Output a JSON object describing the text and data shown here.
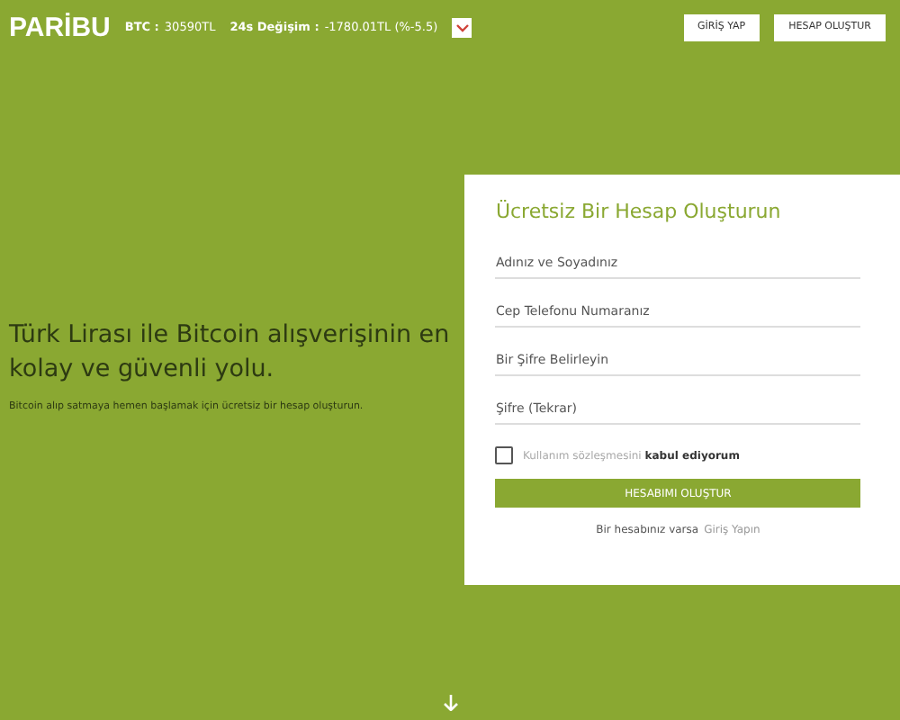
{
  "header": {
    "logo": "PARİBU",
    "ticker": [
      {
        "label": "BTC :",
        "value": "30590TL"
      },
      {
        "label": "24s Değişim :",
        "value": "-1780.01TL (%-5.5)"
      }
    ],
    "buttons": [
      "GİRİŞ YAP",
      "HESAP OLUŞTUR"
    ]
  },
  "hero": {
    "title": "Türk Lirası ile Bitcoin alışverişinin en kolay ve güvenli yolu.",
    "subtitle": "Bitcoin alıp satmaya hemen başlamak için ücretsiz bir hesap oluşturun."
  },
  "signup": {
    "title": "Ücretsiz Bir Hesap Oluşturun",
    "fields": [
      {
        "placeholder": "Adınız ve Soyadınız"
      },
      {
        "placeholder": "Cep Telefonu Numaranız"
      },
      {
        "placeholder": "Bir Şifre Belirleyin"
      },
      {
        "placeholder": "Şifre (Tekrar)"
      }
    ],
    "terms": {
      "label": "Kullanım sözleşmesini **kabul ediyorum**",
      "checked": false
    },
    "submit": "HESABIMI OLUŞTUR",
    "login_prompt": "Bir hesabınız varsa",
    "login_link": "Giriş Yapın"
  }
}
